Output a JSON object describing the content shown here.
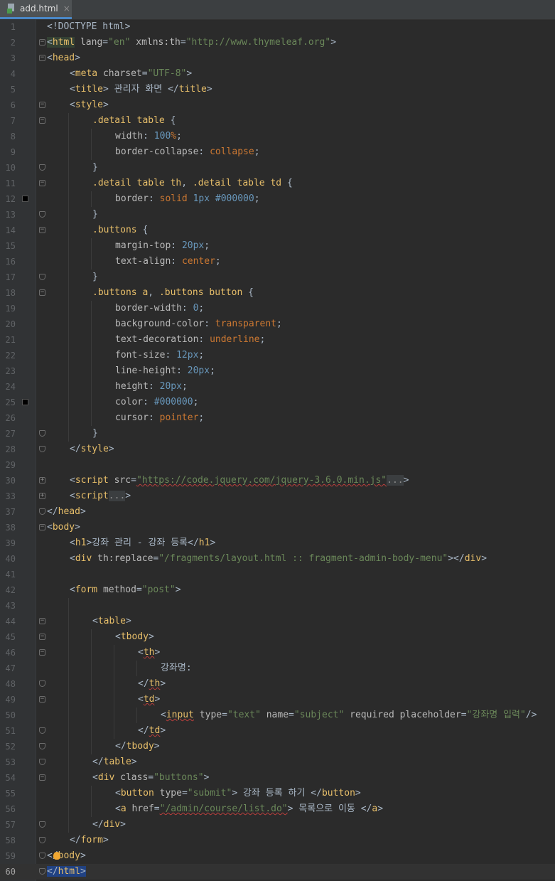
{
  "tab": {
    "label": "add.html",
    "close": "×"
  },
  "current_line": 60,
  "markers": {
    "12": "#000000",
    "25": "#000000"
  },
  "lines": [
    {
      "n": "1",
      "indent": 0,
      "fold": "",
      "tokens": [
        [
          "t-text",
          "<!DOCTYPE html>"
        ]
      ]
    },
    {
      "n": "2",
      "indent": 0,
      "fold": "open",
      "tokens": [
        [
          "t-text t-hl",
          "<"
        ],
        [
          "t-tag t-hl",
          "html"
        ],
        [
          "t-attr",
          " lang"
        ],
        [
          "t-text",
          "="
        ],
        [
          "t-val",
          "\"en\""
        ],
        [
          "t-attr",
          " xmlns:th"
        ],
        [
          "t-text",
          "="
        ],
        [
          "t-val",
          "\"http://www.thymeleaf.org\""
        ],
        [
          "t-text",
          ">"
        ]
      ]
    },
    {
      "n": "3",
      "indent": 0,
      "fold": "open",
      "tokens": [
        [
          "t-text",
          "<"
        ],
        [
          "t-tag",
          "head"
        ],
        [
          "t-text",
          ">"
        ]
      ]
    },
    {
      "n": "4",
      "indent": 1,
      "fold": "",
      "tokens": [
        [
          "t-text",
          "<"
        ],
        [
          "t-tag",
          "meta"
        ],
        [
          "t-attr",
          " charset"
        ],
        [
          "t-text",
          "="
        ],
        [
          "t-val",
          "\"UTF-8\""
        ],
        [
          "t-text",
          ">"
        ]
      ]
    },
    {
      "n": "5",
      "indent": 1,
      "fold": "",
      "tokens": [
        [
          "t-text",
          "<"
        ],
        [
          "t-tag",
          "title"
        ],
        [
          "t-text",
          "> 관리자 화면 </"
        ],
        [
          "t-tag",
          "title"
        ],
        [
          "t-text",
          ">"
        ]
      ]
    },
    {
      "n": "6",
      "indent": 1,
      "fold": "open",
      "tokens": [
        [
          "t-text",
          "<"
        ],
        [
          "t-tag",
          "style"
        ],
        [
          "t-text",
          ">"
        ]
      ]
    },
    {
      "n": "7",
      "indent": 2,
      "fold": "open",
      "tokens": [
        [
          "t-sel",
          ".detail table"
        ],
        [
          "t-text",
          " {"
        ]
      ]
    },
    {
      "n": "8",
      "indent": 3,
      "fold": "",
      "tokens": [
        [
          "t-prop",
          "width"
        ],
        [
          "t-text",
          ": "
        ],
        [
          "t-num",
          "100"
        ],
        [
          "t-kw",
          "%"
        ],
        [
          "t-text",
          ";"
        ]
      ]
    },
    {
      "n": "9",
      "indent": 3,
      "fold": "",
      "tokens": [
        [
          "t-prop",
          "border-collapse"
        ],
        [
          "t-text",
          ": "
        ],
        [
          "t-kw",
          "collapse"
        ],
        [
          "t-text",
          ";"
        ]
      ]
    },
    {
      "n": "10",
      "indent": 2,
      "fold": "end",
      "tokens": [
        [
          "t-text",
          "}"
        ]
      ]
    },
    {
      "n": "11",
      "indent": 2,
      "fold": "open",
      "tokens": [
        [
          "t-sel",
          ".detail table th"
        ],
        [
          "t-text",
          ", "
        ],
        [
          "t-sel",
          ".detail table td"
        ],
        [
          "t-text",
          " {"
        ]
      ]
    },
    {
      "n": "12",
      "indent": 3,
      "fold": "",
      "tokens": [
        [
          "t-prop",
          "border"
        ],
        [
          "t-text",
          ": "
        ],
        [
          "t-kw",
          "solid "
        ],
        [
          "t-num",
          "1px "
        ],
        [
          "t-hex",
          "#000000"
        ],
        [
          "t-text",
          ";"
        ]
      ]
    },
    {
      "n": "13",
      "indent": 2,
      "fold": "end",
      "tokens": [
        [
          "t-text",
          "}"
        ]
      ]
    },
    {
      "n": "14",
      "indent": 2,
      "fold": "open",
      "tokens": [
        [
          "t-sel",
          ".buttons"
        ],
        [
          "t-text",
          " {"
        ]
      ]
    },
    {
      "n": "15",
      "indent": 3,
      "fold": "",
      "tokens": [
        [
          "t-prop",
          "margin-top"
        ],
        [
          "t-text",
          ": "
        ],
        [
          "t-num",
          "20px"
        ],
        [
          "t-text",
          ";"
        ]
      ]
    },
    {
      "n": "16",
      "indent": 3,
      "fold": "",
      "tokens": [
        [
          "t-prop",
          "text-align"
        ],
        [
          "t-text",
          ": "
        ],
        [
          "t-kw",
          "center"
        ],
        [
          "t-text",
          ";"
        ]
      ]
    },
    {
      "n": "17",
      "indent": 2,
      "fold": "end",
      "tokens": [
        [
          "t-text",
          "}"
        ]
      ]
    },
    {
      "n": "18",
      "indent": 2,
      "fold": "open",
      "tokens": [
        [
          "t-sel",
          ".buttons a"
        ],
        [
          "t-text",
          ", "
        ],
        [
          "t-sel",
          ".buttons button"
        ],
        [
          "t-text",
          " {"
        ]
      ]
    },
    {
      "n": "19",
      "indent": 3,
      "fold": "",
      "tokens": [
        [
          "t-prop",
          "border-width"
        ],
        [
          "t-text",
          ": "
        ],
        [
          "t-num",
          "0"
        ],
        [
          "t-text",
          ";"
        ]
      ]
    },
    {
      "n": "20",
      "indent": 3,
      "fold": "",
      "tokens": [
        [
          "t-prop",
          "background-color"
        ],
        [
          "t-text",
          ": "
        ],
        [
          "t-kw",
          "transparent"
        ],
        [
          "t-text",
          ";"
        ]
      ]
    },
    {
      "n": "21",
      "indent": 3,
      "fold": "",
      "tokens": [
        [
          "t-prop",
          "text-decoration"
        ],
        [
          "t-text",
          ": "
        ],
        [
          "t-kw",
          "underline"
        ],
        [
          "t-text",
          ";"
        ]
      ]
    },
    {
      "n": "22",
      "indent": 3,
      "fold": "",
      "tokens": [
        [
          "t-prop",
          "font-size"
        ],
        [
          "t-text",
          ": "
        ],
        [
          "t-num",
          "12px"
        ],
        [
          "t-text",
          ";"
        ]
      ]
    },
    {
      "n": "23",
      "indent": 3,
      "fold": "",
      "tokens": [
        [
          "t-prop",
          "line-height"
        ],
        [
          "t-text",
          ": "
        ],
        [
          "t-num",
          "20px"
        ],
        [
          "t-text",
          ";"
        ]
      ]
    },
    {
      "n": "24",
      "indent": 3,
      "fold": "",
      "tokens": [
        [
          "t-prop",
          "height"
        ],
        [
          "t-text",
          ": "
        ],
        [
          "t-num",
          "20px"
        ],
        [
          "t-text",
          ";"
        ]
      ]
    },
    {
      "n": "25",
      "indent": 3,
      "fold": "",
      "tokens": [
        [
          "t-prop",
          "color"
        ],
        [
          "t-text",
          ": "
        ],
        [
          "t-hex",
          "#000000"
        ],
        [
          "t-text",
          ";"
        ]
      ]
    },
    {
      "n": "26",
      "indent": 3,
      "fold": "",
      "tokens": [
        [
          "t-prop",
          "cursor"
        ],
        [
          "t-text",
          ": "
        ],
        [
          "t-kw",
          "pointer"
        ],
        [
          "t-text",
          ";"
        ]
      ]
    },
    {
      "n": "27",
      "indent": 2,
      "fold": "end",
      "tokens": [
        [
          "t-text",
          "}"
        ]
      ]
    },
    {
      "n": "28",
      "indent": 1,
      "fold": "end",
      "tokens": [
        [
          "t-text",
          "</"
        ],
        [
          "t-tag",
          "style"
        ],
        [
          "t-text",
          ">"
        ]
      ]
    },
    {
      "n": "29",
      "indent": 1,
      "fold": "",
      "tokens": []
    },
    {
      "n": "30",
      "indent": 1,
      "fold": "plus",
      "tokens": [
        [
          "t-text",
          "<"
        ],
        [
          "t-tag",
          "script"
        ],
        [
          "t-attr",
          " src"
        ],
        [
          "t-text",
          "="
        ],
        [
          "t-val wave",
          "\"https://code.jquery.com/jquery-3.6.0.min.js\""
        ],
        [
          "t-fold",
          "..."
        ],
        [
          "t-text",
          ">"
        ]
      ]
    },
    {
      "n": "33",
      "indent": 1,
      "fold": "plus",
      "tokens": [
        [
          "t-text",
          "<"
        ],
        [
          "t-tag",
          "script"
        ],
        [
          "t-fold",
          "..."
        ],
        [
          "t-text",
          ">"
        ]
      ]
    },
    {
      "n": "37",
      "indent": 0,
      "fold": "end",
      "tokens": [
        [
          "t-text",
          "</"
        ],
        [
          "t-tag",
          "head"
        ],
        [
          "t-text",
          ">"
        ]
      ]
    },
    {
      "n": "38",
      "indent": 0,
      "fold": "open",
      "tokens": [
        [
          "t-text",
          "<"
        ],
        [
          "t-tag",
          "body"
        ],
        [
          "t-text",
          ">"
        ]
      ]
    },
    {
      "n": "39",
      "indent": 1,
      "fold": "",
      "tokens": [
        [
          "t-text",
          "<"
        ],
        [
          "t-tag",
          "h1"
        ],
        [
          "t-text",
          ">강좌 관리 - 강좌 등록</"
        ],
        [
          "t-tag",
          "h1"
        ],
        [
          "t-text",
          ">"
        ]
      ]
    },
    {
      "n": "40",
      "indent": 1,
      "fold": "",
      "tokens": [
        [
          "t-text",
          "<"
        ],
        [
          "t-tag",
          "div"
        ],
        [
          "t-attr",
          " th:replace"
        ],
        [
          "t-text",
          "="
        ],
        [
          "t-val",
          "\"/fragments/layout.html :: fragment-admin-body-menu\""
        ],
        [
          "t-text",
          "></"
        ],
        [
          "t-tag",
          "div"
        ],
        [
          "t-text",
          ">"
        ]
      ]
    },
    {
      "n": "41",
      "indent": 1,
      "fold": "",
      "tokens": []
    },
    {
      "n": "42",
      "indent": 1,
      "fold": "",
      "tokens": [
        [
          "t-text",
          "<"
        ],
        [
          "t-tag",
          "form"
        ],
        [
          "t-attr",
          " method"
        ],
        [
          "t-text",
          "="
        ],
        [
          "t-val",
          "\"post\""
        ],
        [
          "t-text",
          ">"
        ]
      ]
    },
    {
      "n": "43",
      "indent": 2,
      "fold": "",
      "tokens": []
    },
    {
      "n": "44",
      "indent": 2,
      "fold": "open",
      "tokens": [
        [
          "t-text",
          "<"
        ],
        [
          "t-tag",
          "table"
        ],
        [
          "t-text",
          ">"
        ]
      ]
    },
    {
      "n": "45",
      "indent": 3,
      "fold": "open",
      "tokens": [
        [
          "t-text",
          "<"
        ],
        [
          "t-tag",
          "tbody"
        ],
        [
          "t-text",
          ">"
        ]
      ]
    },
    {
      "n": "46",
      "indent": 4,
      "fold": "open",
      "tokens": [
        [
          "t-text",
          "<"
        ],
        [
          "t-tag wave",
          "th"
        ],
        [
          "t-text",
          ">"
        ]
      ]
    },
    {
      "n": "47",
      "indent": 5,
      "fold": "",
      "tokens": [
        [
          "t-text",
          "강좌명:"
        ]
      ]
    },
    {
      "n": "48",
      "indent": 4,
      "fold": "end",
      "tokens": [
        [
          "t-text",
          "</"
        ],
        [
          "t-tag wave",
          "th"
        ],
        [
          "t-text",
          ">"
        ]
      ]
    },
    {
      "n": "49",
      "indent": 4,
      "fold": "open",
      "tokens": [
        [
          "t-text",
          "<"
        ],
        [
          "t-tag wave",
          "td"
        ],
        [
          "t-text",
          ">"
        ]
      ]
    },
    {
      "n": "50",
      "indent": 5,
      "fold": "",
      "tokens": [
        [
          "t-text",
          "<"
        ],
        [
          "t-tag wave",
          "input"
        ],
        [
          "t-attr",
          " type"
        ],
        [
          "t-text",
          "="
        ],
        [
          "t-val",
          "\"text\""
        ],
        [
          "t-attr",
          " name"
        ],
        [
          "t-text",
          "="
        ],
        [
          "t-val",
          "\"subject\""
        ],
        [
          "t-attr",
          " required placeholder"
        ],
        [
          "t-text",
          "="
        ],
        [
          "t-val",
          "\"강좌명 입력\""
        ],
        [
          "t-text",
          "/>"
        ]
      ]
    },
    {
      "n": "51",
      "indent": 4,
      "fold": "end",
      "tokens": [
        [
          "t-text",
          "</"
        ],
        [
          "t-tag wave",
          "td"
        ],
        [
          "t-text",
          ">"
        ]
      ]
    },
    {
      "n": "52",
      "indent": 3,
      "fold": "end",
      "tokens": [
        [
          "t-text",
          "</"
        ],
        [
          "t-tag",
          "tbody"
        ],
        [
          "t-text",
          ">"
        ]
      ]
    },
    {
      "n": "53",
      "indent": 2,
      "fold": "end",
      "tokens": [
        [
          "t-text",
          "</"
        ],
        [
          "t-tag",
          "table"
        ],
        [
          "t-text",
          ">"
        ]
      ]
    },
    {
      "n": "54",
      "indent": 2,
      "fold": "open",
      "tokens": [
        [
          "t-text",
          "<"
        ],
        [
          "t-tag",
          "div"
        ],
        [
          "t-attr",
          " class"
        ],
        [
          "t-text",
          "="
        ],
        [
          "t-val",
          "\"buttons\""
        ],
        [
          "t-text",
          ">"
        ]
      ]
    },
    {
      "n": "55",
      "indent": 3,
      "fold": "",
      "tokens": [
        [
          "t-text",
          "<"
        ],
        [
          "t-tag",
          "button"
        ],
        [
          "t-attr",
          " type"
        ],
        [
          "t-text",
          "="
        ],
        [
          "t-val",
          "\"submit\""
        ],
        [
          "t-text",
          "> 강좌 등록 하기 </"
        ],
        [
          "t-tag",
          "button"
        ],
        [
          "t-text",
          ">"
        ]
      ]
    },
    {
      "n": "56",
      "indent": 3,
      "fold": "",
      "tokens": [
        [
          "t-text",
          "<"
        ],
        [
          "t-tag",
          "a"
        ],
        [
          "t-attr",
          " href"
        ],
        [
          "t-text",
          "="
        ],
        [
          "t-val wave",
          "\"/admin/course/list.do\""
        ],
        [
          "t-text",
          "> 목록으로 이동 </"
        ],
        [
          "t-tag",
          "a"
        ],
        [
          "t-text",
          ">"
        ]
      ]
    },
    {
      "n": "57",
      "indent": 2,
      "fold": "end",
      "tokens": [
        [
          "t-text",
          "</"
        ],
        [
          "t-tag",
          "div"
        ],
        [
          "t-text",
          ">"
        ]
      ]
    },
    {
      "n": "58",
      "indent": 1,
      "fold": "end",
      "tokens": [
        [
          "t-text",
          "</"
        ],
        [
          "t-tag",
          "form"
        ],
        [
          "t-text",
          ">"
        ]
      ]
    },
    {
      "n": "59",
      "indent": 0,
      "fold": "end",
      "bulb": true,
      "tokens": [
        [
          "t-text",
          "</"
        ],
        [
          "t-tag",
          "body"
        ],
        [
          "t-text",
          ">"
        ]
      ]
    },
    {
      "n": "60",
      "indent": 0,
      "fold": "end",
      "tokens": [
        [
          "t-text t-sel-bg",
          "</"
        ],
        [
          "t-tag t-sel-bg",
          "html"
        ],
        [
          "t-text t-sel-bg",
          ">"
        ]
      ]
    }
  ]
}
